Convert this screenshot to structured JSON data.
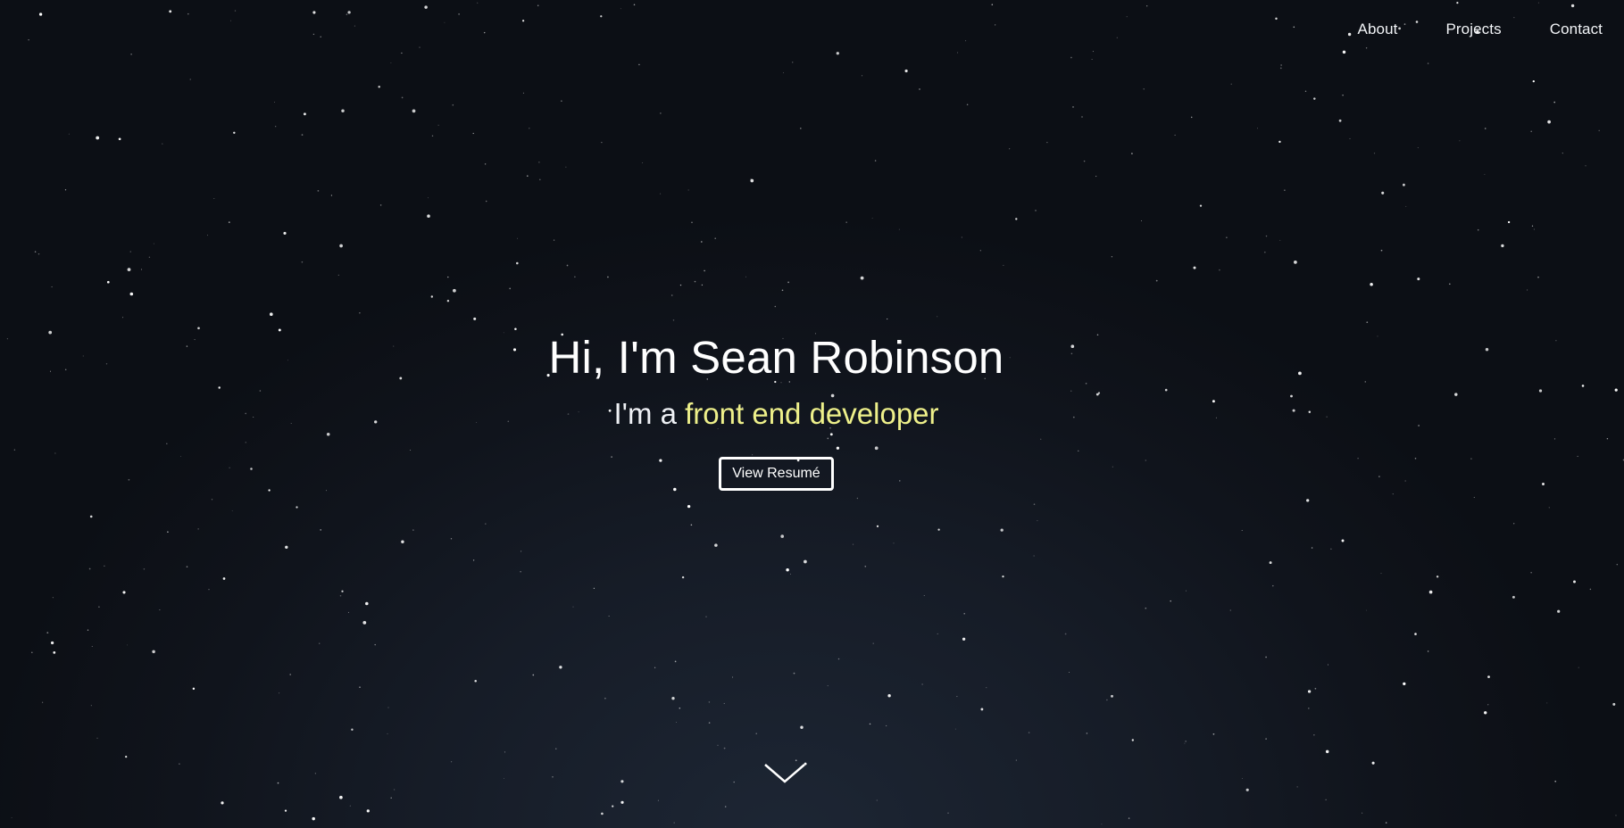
{
  "nav": {
    "items": [
      "About",
      "Projects",
      "Contact"
    ]
  },
  "hero": {
    "title": "Hi, I'm Sean Robinson",
    "subtitle_prefix": "I'm a ",
    "subtitle_accent": "front end developer",
    "button_label": "View Resumé",
    "scroll_icon": "chevron-down-icon"
  },
  "colors": {
    "accent": "#eef08a",
    "background": "#0d1017",
    "text": "#ffffff"
  }
}
